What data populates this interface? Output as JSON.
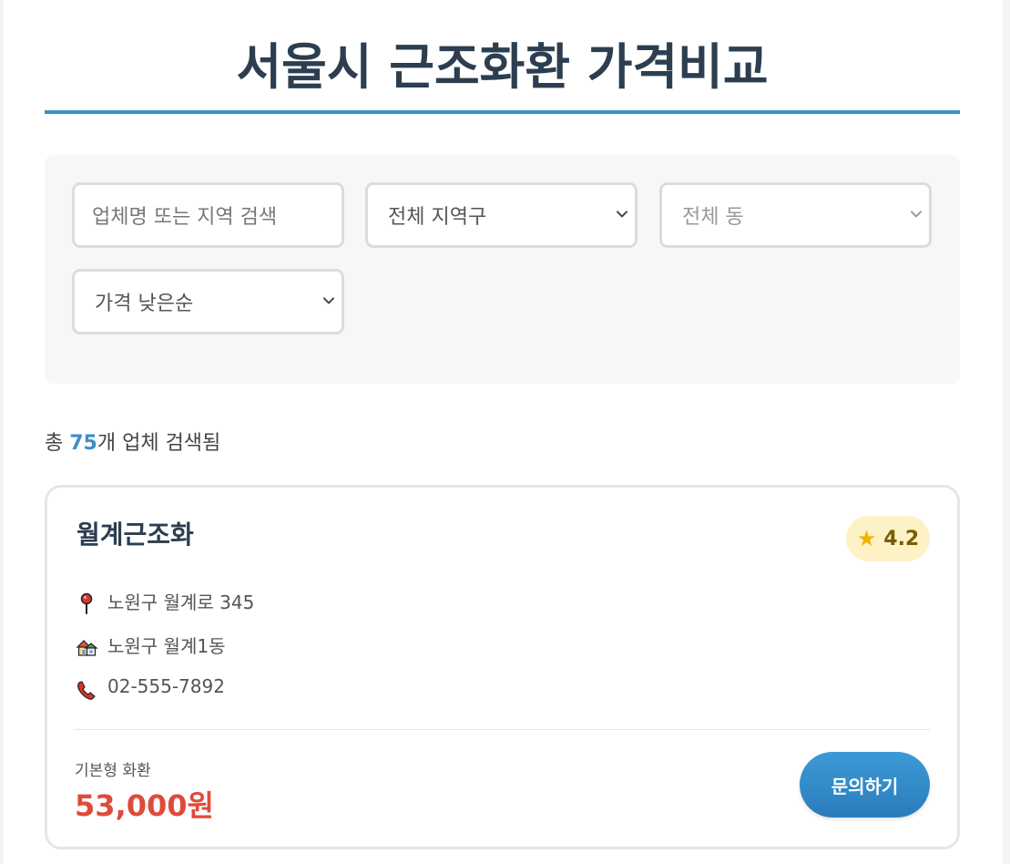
{
  "header": {
    "title": "서울시 근조화환 가격비교"
  },
  "filters": {
    "search_placeholder": "업체명 또는 지역 검색",
    "district_select": "전체 지역구",
    "dong_select": "전체 동",
    "sort_select": "가격 낮은순"
  },
  "results": {
    "prefix": "총 ",
    "count": "75",
    "suffix": "개 업체 검색됨"
  },
  "listing": {
    "name": "월계근조화",
    "rating": "4.2",
    "address": "노원구 월계로 345",
    "area": "노원구 월계1동",
    "phone": "02-555-7892",
    "price_label": "기본형 화환",
    "price": "53,000원",
    "inquiry_label": "문의하기"
  },
  "colors": {
    "title": "#2c3e50",
    "accent": "#3a8fc8",
    "price": "#e04a3a",
    "rating_bg": "#fdf1c6",
    "button": "#2f86c4"
  },
  "icons": {
    "rating": "star-icon",
    "address": "map-pin-icon",
    "area": "house-icon",
    "phone": "phone-icon",
    "select": "chevron-down-icon"
  }
}
